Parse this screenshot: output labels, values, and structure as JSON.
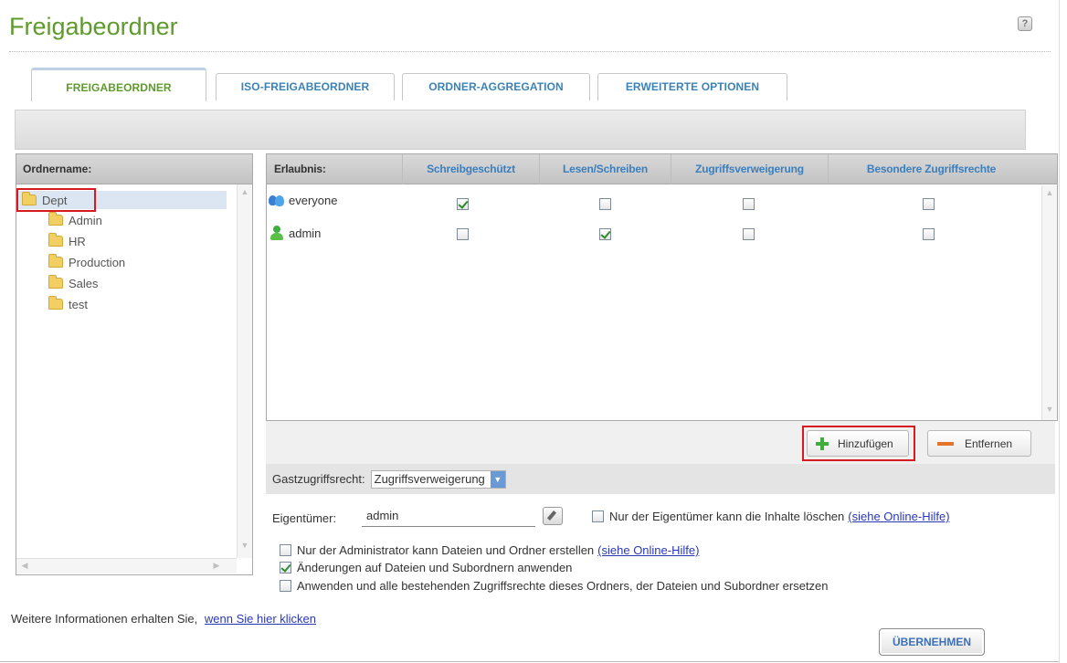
{
  "title": "Freigabeordner",
  "tabs": [
    "FREIGABEORDNER",
    "ISO-FREIGABEORDNER",
    "ORDNER-AGGREGATION",
    "ERWEITERTE OPTIONEN"
  ],
  "tree": {
    "header": "Ordnername:",
    "root": "Dept",
    "children": [
      "Admin",
      "HR",
      "Production",
      "Sales",
      "test"
    ]
  },
  "permissions": {
    "columns": [
      "Erlaubnis:",
      "Schreibgeschützt",
      "Lesen/Schreiben",
      "Zugriffsverweigerung",
      "Besondere Zugriffsrechte"
    ],
    "rows": [
      {
        "name": "everyone",
        "icon": "group-icon",
        "values": [
          true,
          false,
          false,
          false
        ]
      },
      {
        "name": "admin",
        "icon": "user-icon",
        "values": [
          false,
          true,
          false,
          false
        ]
      }
    ]
  },
  "buttons": {
    "add": "Hinzufügen",
    "remove": "Entfernen",
    "apply": "ÜBERNEHMEN"
  },
  "guest": {
    "label": "Gastzugriffsrecht:",
    "value": "Zugriffsverweigerung"
  },
  "owner": {
    "label": "Eigentümer:",
    "value": "admin",
    "only_owner_delete": {
      "checked": false,
      "label": "Nur der Eigentümer kann die Inhalte löschen",
      "link": "(siehe Online-Hilfe)"
    }
  },
  "options": [
    {
      "checked": false,
      "label": "Nur der Administrator kann Dateien und Ordner erstellen",
      "link": "(siehe Online-Hilfe)"
    },
    {
      "checked": true,
      "label": "Änderungen auf Dateien und Subordnern anwenden",
      "link": ""
    },
    {
      "checked": false,
      "label": "Anwenden und alle bestehenden Zugriffsrechte dieses Ordners, der Dateien und Subordner ersetzen",
      "link": ""
    }
  ],
  "info": {
    "text": "Weitere Informationen erhalten Sie,",
    "link": "wenn Sie hier klicken"
  },
  "colors": {
    "title_green": "#5e9a2c",
    "tab_blue": "#3b82b6",
    "highlight_red": "#d71a20"
  }
}
